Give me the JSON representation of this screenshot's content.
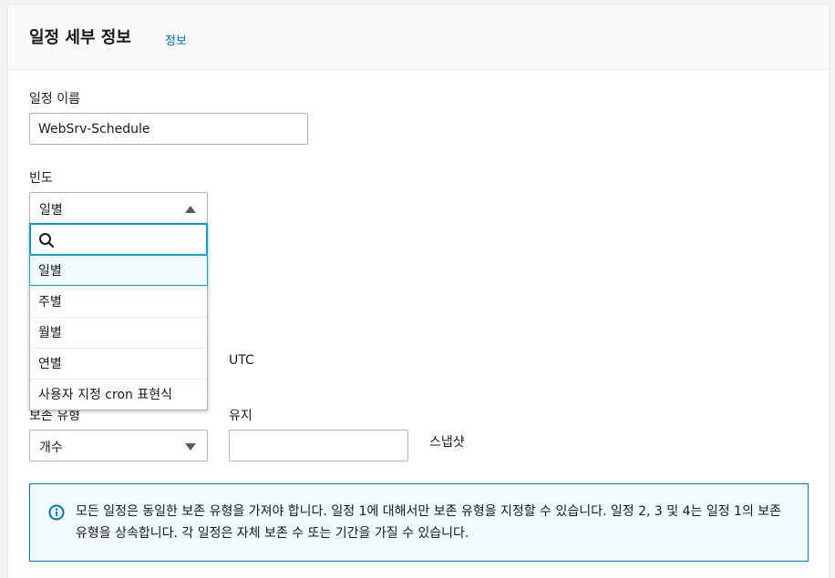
{
  "header": {
    "title": "일정 세부 정보",
    "info_link": "정보"
  },
  "schedule_name": {
    "label": "일정 이름",
    "value": "WebSrv-Schedule"
  },
  "frequency": {
    "label": "빈도",
    "selected": "일별",
    "search_placeholder": "",
    "options": [
      "일별",
      "주별",
      "월별",
      "연별",
      "사용자 지정 cron 표현식"
    ]
  },
  "timezone_label": "UTC",
  "retention_type": {
    "label": "보존 유형",
    "selected": "개수"
  },
  "retain": {
    "label": "유지",
    "value": "",
    "unit": "스냅샷"
  },
  "alert": {
    "icon": "info-circle-icon",
    "text": "모든 일정은 동일한 보존 유형을 가져야 합니다. 일정 1에 대해서만 보존 유형을 지정할 수 있습니다. 일정 2, 3 및 4는 일정 1의 보존 유형을 상속합니다. 각 일정은 자체 보존 수 또는 기간을 가질 수 있습니다."
  },
  "colors": {
    "link": "#0073bb",
    "focus": "#00a1c9",
    "alert_bg": "#f1faff"
  }
}
